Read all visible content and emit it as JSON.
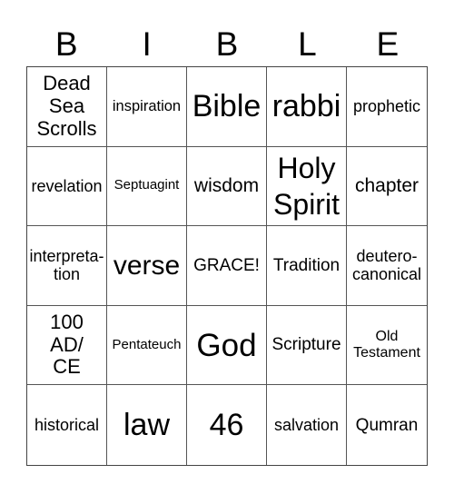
{
  "title_letters": [
    "B",
    "I",
    "B",
    "L",
    "E"
  ],
  "rows": [
    [
      "Dead Sea Scrolls",
      "inspiration",
      "Bible",
      "rabbi",
      "prophetic"
    ],
    [
      "revelation",
      "Septuagint",
      "wisdom",
      "Holy Spirit",
      "chapter"
    ],
    [
      "interpreta-tion",
      "verse",
      "GRACE!",
      "Tradition",
      "deutero-canonical"
    ],
    [
      "100 AD/ CE",
      "Pentateuch",
      "God",
      "Scripture",
      "Old Testament"
    ],
    [
      "historical",
      "law",
      "46",
      "salvation",
      "Qumran"
    ]
  ],
  "colors": {
    "border": "#555555",
    "text": "#000000",
    "background": "#ffffff"
  }
}
